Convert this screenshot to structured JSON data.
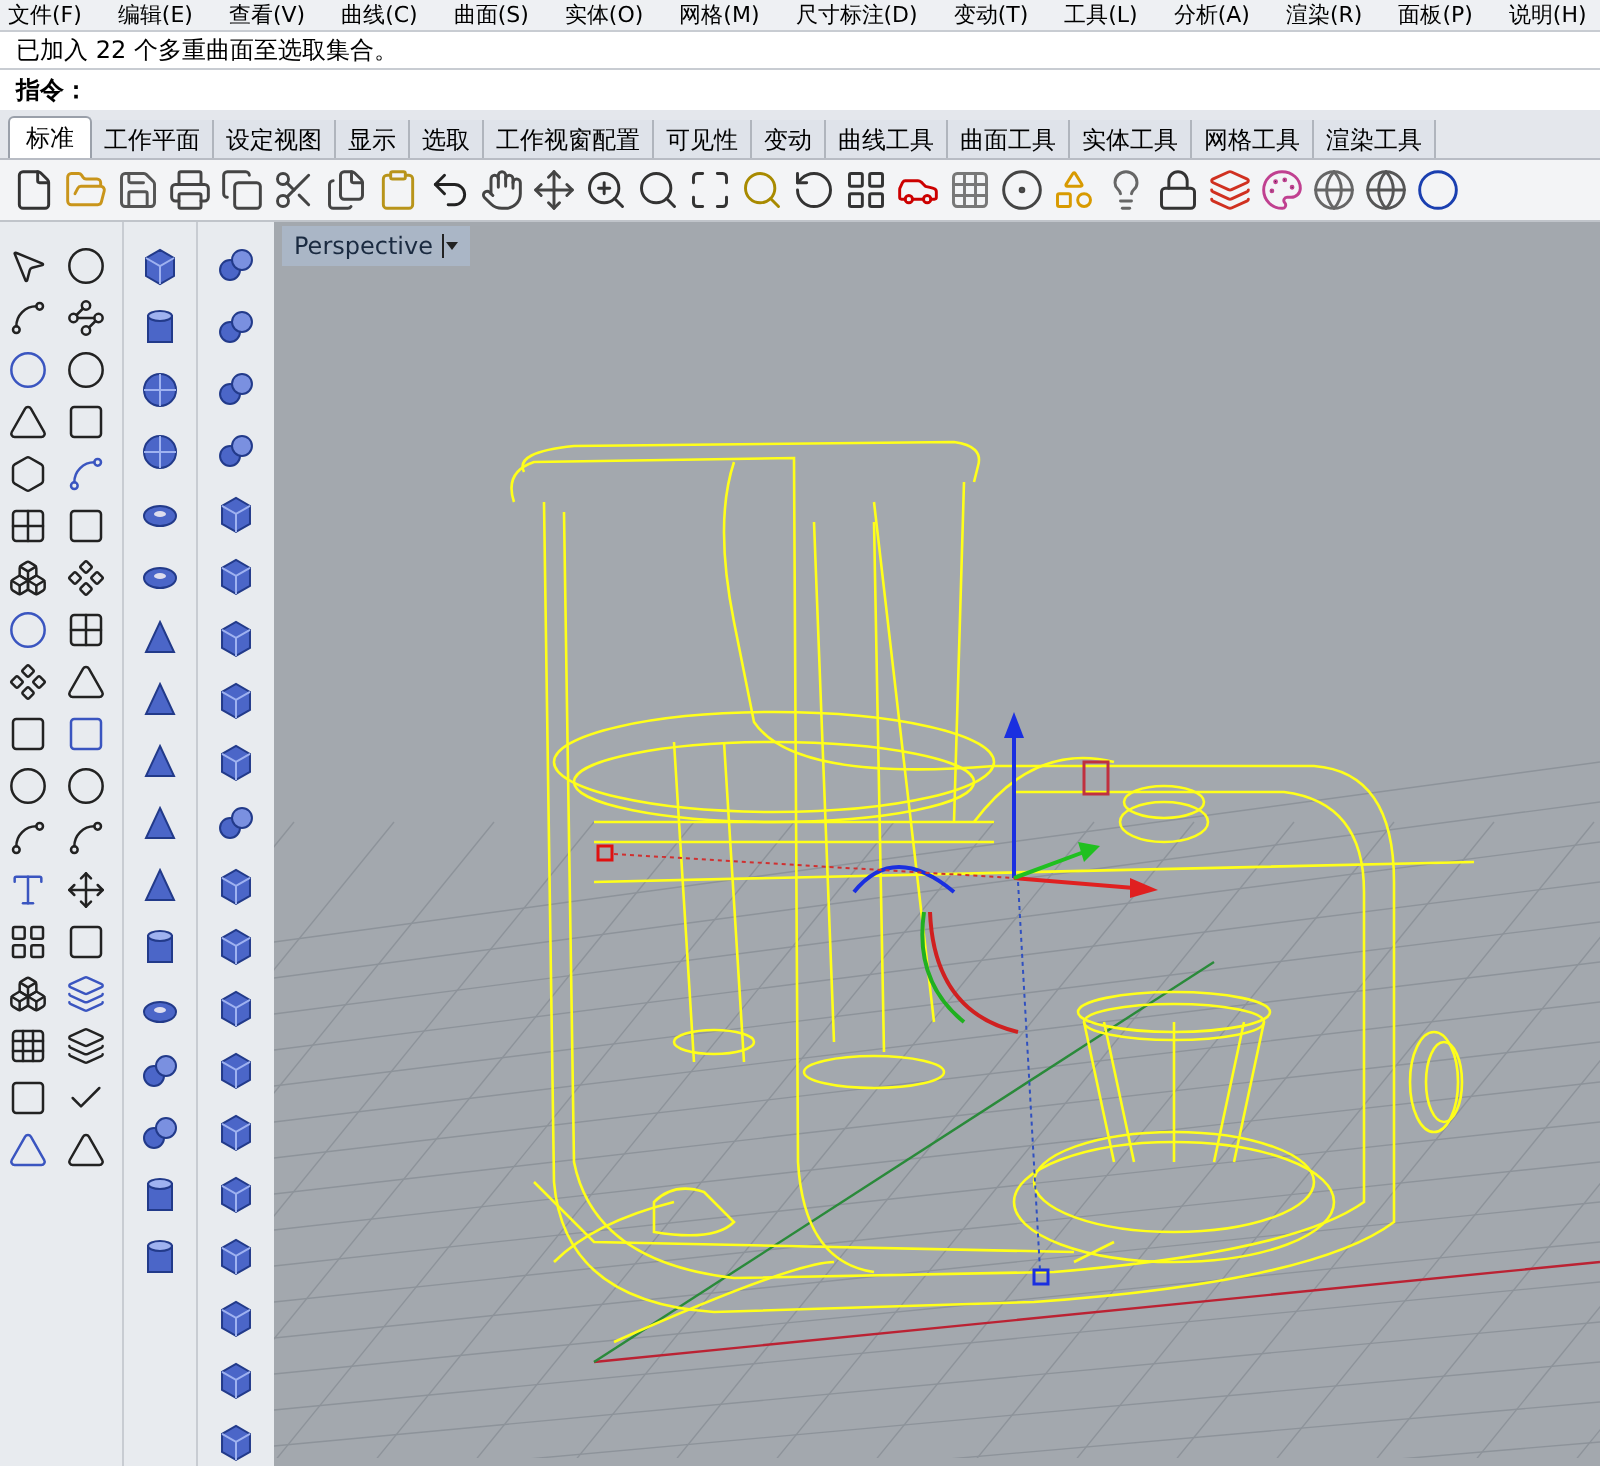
{
  "menu": [
    "文件(F)",
    "编辑(E)",
    "查看(V)",
    "曲线(C)",
    "曲面(S)",
    "实体(O)",
    "网格(M)",
    "尺寸标注(D)",
    "变动(T)",
    "工具(L)",
    "分析(A)",
    "渲染(R)",
    "面板(P)",
    "说明(H)"
  ],
  "history": "已加入 22 个多重曲面至选取集合。",
  "command": {
    "label": "指令："
  },
  "tabs": [
    {
      "label": "标准",
      "selected": true
    },
    {
      "label": "工作平面",
      "selected": false
    },
    {
      "label": "设定视图",
      "selected": false
    },
    {
      "label": "显示",
      "selected": false
    },
    {
      "label": "选取",
      "selected": false
    },
    {
      "label": "工作视窗配置",
      "selected": false
    },
    {
      "label": "可见性",
      "selected": false
    },
    {
      "label": "变动",
      "selected": false
    },
    {
      "label": "曲线工具",
      "selected": false
    },
    {
      "label": "曲面工具",
      "selected": false
    },
    {
      "label": "实体工具",
      "selected": false
    },
    {
      "label": "网格工具",
      "selected": false
    },
    {
      "label": "渲染工具",
      "selected": false
    }
  ],
  "viewport": {
    "title": "Perspective"
  }
}
